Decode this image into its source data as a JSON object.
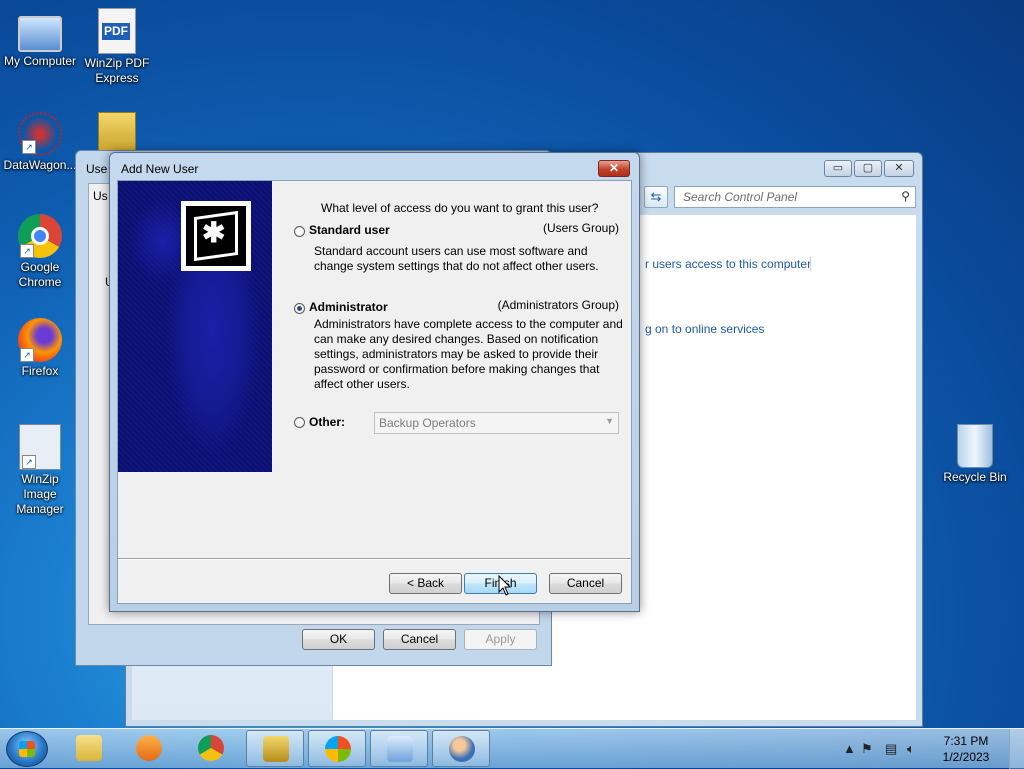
{
  "desktop": {
    "icons": [
      {
        "label": "My Computer",
        "icon": "computer-icon"
      },
      {
        "label": "WinZip PDF Express",
        "icon": "pdf-icon"
      },
      {
        "label": "DataWagon...",
        "icon": "datawagon-icon"
      },
      {
        "label": "Google Chrome",
        "icon": "chrome-icon"
      },
      {
        "label": "Firefox",
        "icon": "firefox-icon"
      },
      {
        "label": "WinZip Image Manager",
        "icon": "winzip-image-icon"
      },
      {
        "label": "Recycle Bin",
        "icon": "recycle-bin-icon"
      }
    ]
  },
  "control_panel": {
    "search_placeholder": "Search Control Panel",
    "link_access": "r users access to this computer",
    "link_online": "g on to online services"
  },
  "user_accounts": {
    "title": "Use",
    "tab": "Us",
    "label2": "U",
    "ok": "OK",
    "cancel": "Cancel",
    "apply": "Apply"
  },
  "wizard": {
    "title": "Add New User",
    "question": "What level of access do you want to grant this user?",
    "options": [
      {
        "label": "Standard user",
        "group": "(Users Group)",
        "description": "Standard account users can use most software and change system settings that do not affect other users.",
        "checked": false
      },
      {
        "label": "Administrator",
        "group": "(Administrators Group)",
        "description": "Administrators have complete access to the computer and can make any desired changes. Based on notification settings, administrators may be asked to provide their password or confirmation before making changes that affect other users.",
        "checked": true
      },
      {
        "label": "Other:",
        "combo_value": "Backup Operators",
        "checked": false
      }
    ],
    "back": "< Back",
    "finish": "Finish",
    "cancel": "Cancel"
  },
  "taskbar": {
    "time": "7:31 PM",
    "date": "1/2/2023",
    "apps": [
      "explorer-icon",
      "media-player-icon",
      "chrome-icon",
      "winzip-icon",
      "windows-update-icon",
      "control-panel-icon",
      "users-icon"
    ]
  }
}
